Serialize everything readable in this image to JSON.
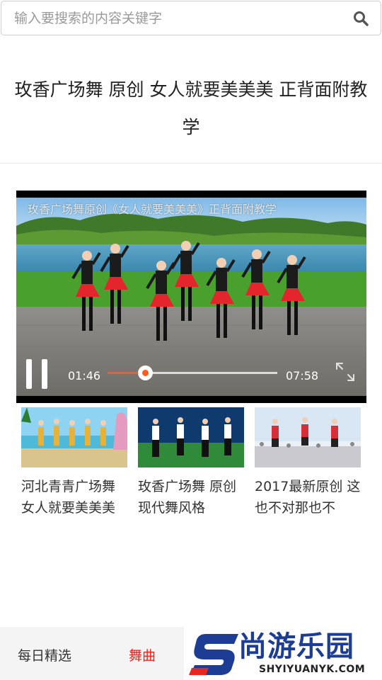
{
  "search": {
    "placeholder": "输入要搜索的内容关键字",
    "value": "",
    "icon": "search-icon"
  },
  "page": {
    "title": "玫香广场舞 原创 女人就要美美美 正背面附教学"
  },
  "player": {
    "caption": "玫香广场舞原创《女人就要美美美》正背面附教学",
    "current_time": "01:46",
    "total_time": "07:58",
    "progress": 0.22,
    "state": "playing",
    "accent_color": "#ff5a1e"
  },
  "related": [
    {
      "title": "河北青青广场舞 女人就要美美美"
    },
    {
      "title": "玫香广场舞 原创现代舞风格"
    },
    {
      "title": "2017最新原创 这也不对那也不"
    }
  ],
  "bottom_nav": {
    "daily_label": "每日精选",
    "music_label": "舞曲",
    "active_color": "#e8261d"
  },
  "logo": {
    "text": "尚游乐园",
    "domain": "SHYIYUANYK.COM"
  }
}
